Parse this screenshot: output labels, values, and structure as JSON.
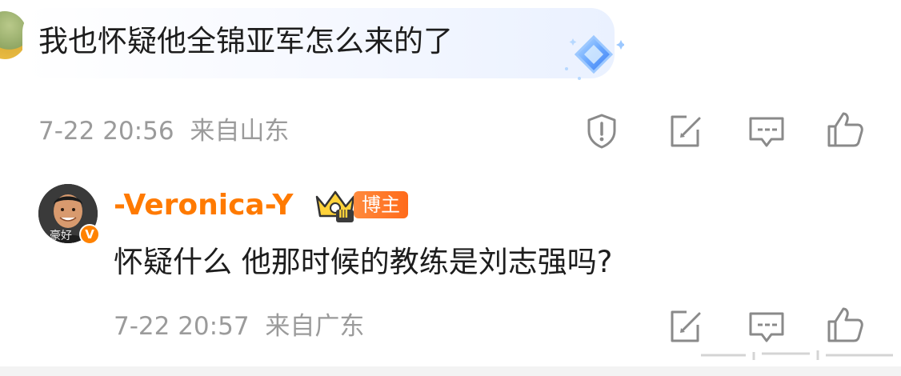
{
  "top_comment": {
    "text": "我也怀疑他全锦亚军怎么来的了",
    "time": "7-22 20:56",
    "location": "来自山东",
    "sticker_icon": "diamond-sticker-icon",
    "actions": [
      "report-icon",
      "repost-icon",
      "comment-icon",
      "like-icon"
    ]
  },
  "reply": {
    "username": "-Veronica-Y",
    "crown_icon": "crown-level-icon",
    "crown_level": "Ⅲ",
    "badge": "博主",
    "avatar_caption": "豪好",
    "verify_mark": "V",
    "text": "怀疑什么 他那时候的教练是刘志强吗?",
    "time": "7-22 20:57",
    "location": "来自广东",
    "actions": [
      "repost-icon",
      "comment-icon",
      "like-icon"
    ]
  },
  "colors": {
    "meta_gray": "#9b9b9b",
    "username_orange": "#ff7a00",
    "icon_gray": "#8a8a8a",
    "bubble_blue": "#eaf1ff"
  }
}
